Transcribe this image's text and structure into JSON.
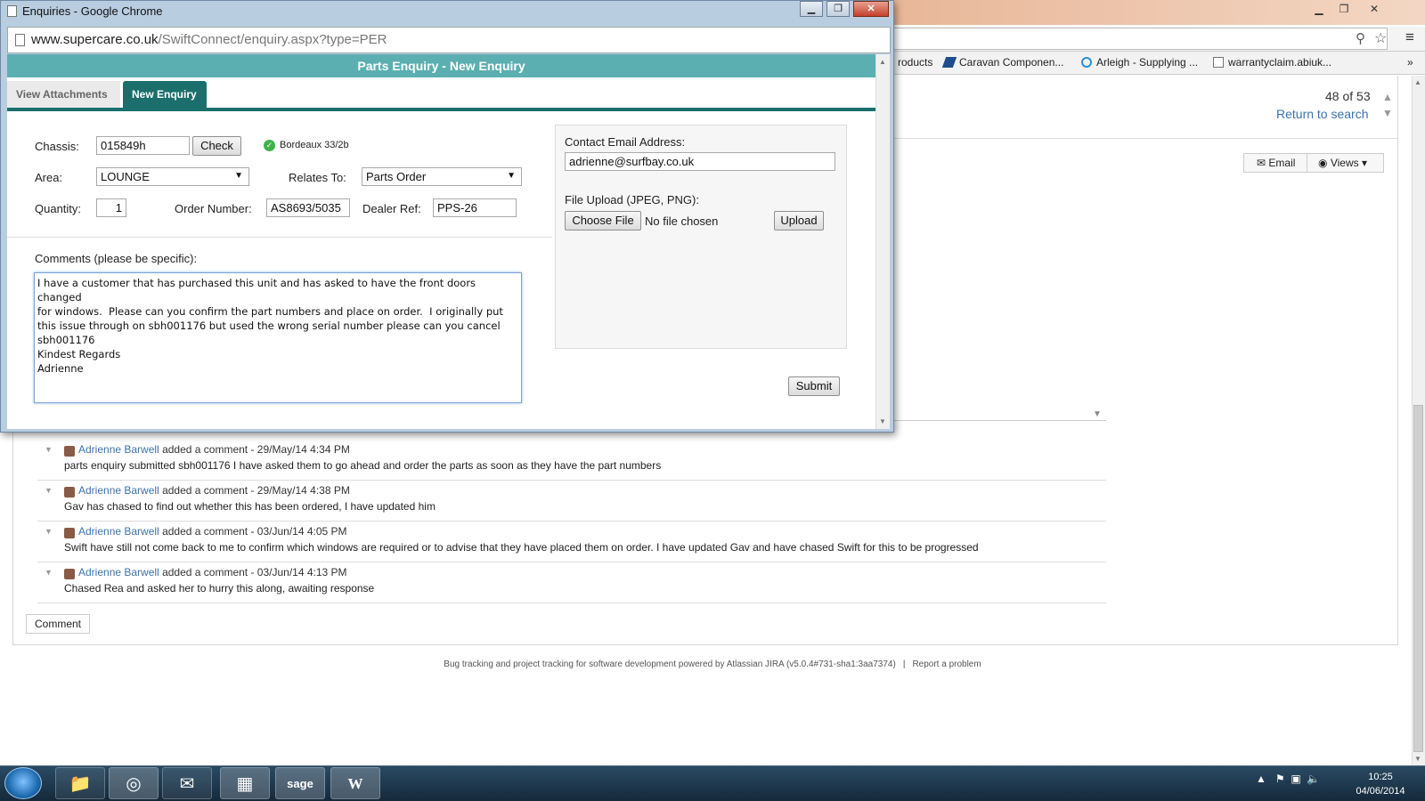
{
  "background": {
    "bookmarks": [
      "roducts",
      "Caravan Componen...",
      "Arleigh - Supplying ...",
      "warrantyclaim.abiuk..."
    ],
    "bookmarks_more": "»",
    "pager_text": "48 of 53",
    "return_link": "Return to search",
    "email_button": "Email",
    "views_button": "Views",
    "comments": [
      {
        "author": "Adrienne Barwell",
        "action": "added a comment - 29/May/14 4:34 PM",
        "body": "parts enquiry submitted sbh001176 I have asked them to go ahead and order the parts as soon as they have the part numbers"
      },
      {
        "author": "Adrienne Barwell",
        "action": "added a comment - 29/May/14 4:38 PM",
        "body": "Gav has chased to find out whether this has been ordered, I have updated him"
      },
      {
        "author": "Adrienne Barwell",
        "action": "added a comment - 03/Jun/14 4:05 PM",
        "body": "Swift have still not come back to me to confirm which windows are required or to advise that they have placed them on order. I have updated Gav and have chased Swift for this to be progressed"
      },
      {
        "author": "Adrienne Barwell",
        "action": "added a comment - 03/Jun/14 4:13 PM",
        "body": "Chased Rea and asked her to hurry this along, awaiting response"
      }
    ],
    "comment_button": "Comment",
    "footer_text": "Bug tracking and project tracking for software development powered by Atlassian JIRA (v5.0.4#731-sha1:3aa7374)",
    "footer_sep": "|",
    "footer_report": "Report a problem"
  },
  "popup": {
    "window_title": "Enquiries - Google Chrome",
    "url_domain": "www.supercare.co.uk",
    "url_path": "/SwiftConnect/enquiry.aspx?type=PER",
    "header": "Parts Enquiry - New Enquiry",
    "tabs": [
      "View Attachments",
      "New Enquiry"
    ],
    "form": {
      "chassis_label": "Chassis:",
      "chassis_value": "015849h",
      "check_button": "Check",
      "check_result": "Bordeaux 33/2b",
      "area_label": "Area:",
      "area_value": "LOUNGE",
      "relates_label": "Relates To:",
      "relates_value": "Parts Order",
      "quantity_label": "Quantity:",
      "quantity_value": "1",
      "order_label": "Order Number:",
      "order_value": "AS8693/5035",
      "dealer_label": "Dealer Ref:",
      "dealer_value": "PPS-26",
      "comments_label": "Comments (please be specific):",
      "comments_value": "I have a customer that has purchased this unit and has asked to have the front doors changed\nfor windows.  Please can you confirm the part numbers and place on order.  I originally put\nthis issue through on sbh001176 but used the wrong serial number please can you cancel\nsbh001176\nKindest Regards\nAdrienne",
      "email_label": "Contact Email Address:",
      "email_value": "adrienne@surfbay.co.uk",
      "upload_label": "File Upload (JPEG, PNG):",
      "choose_file_button": "Choose File",
      "no_file_text": "No file chosen",
      "upload_button": "Upload",
      "submit_button": "Submit"
    }
  },
  "taskbar": {
    "time": "10:25",
    "date": "04/06/2014",
    "sage_label": "sage"
  }
}
